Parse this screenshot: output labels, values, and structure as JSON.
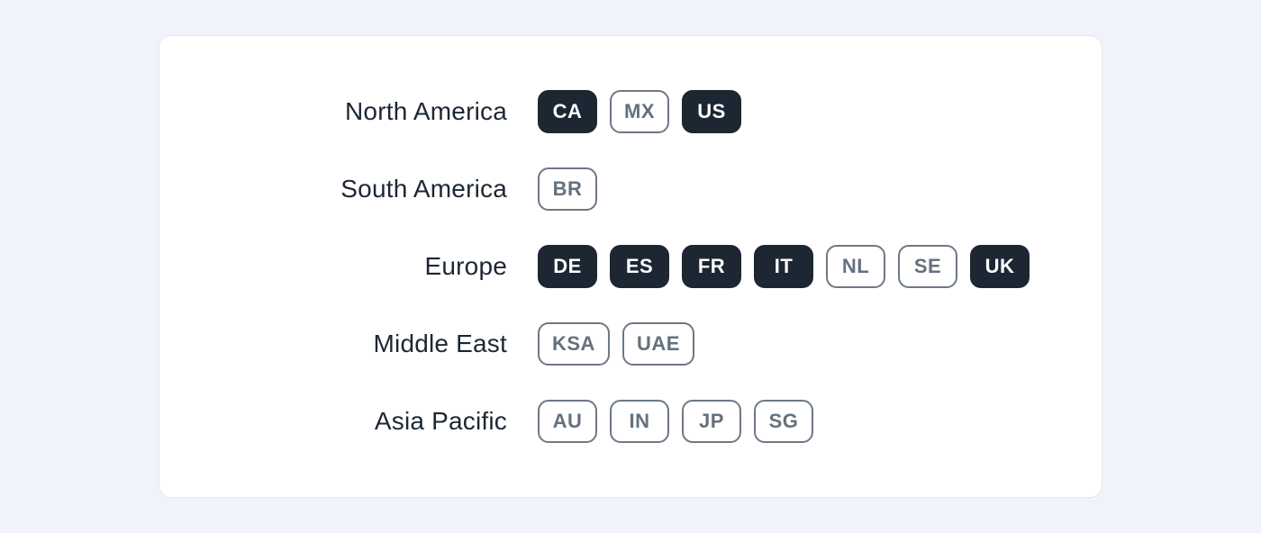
{
  "regions": [
    {
      "label": "North America",
      "chips": [
        {
          "code": "CA",
          "selected": true
        },
        {
          "code": "MX",
          "selected": false
        },
        {
          "code": "US",
          "selected": true
        }
      ]
    },
    {
      "label": "South America",
      "chips": [
        {
          "code": "BR",
          "selected": false
        }
      ]
    },
    {
      "label": "Europe",
      "chips": [
        {
          "code": "DE",
          "selected": true
        },
        {
          "code": "ES",
          "selected": true
        },
        {
          "code": "FR",
          "selected": true
        },
        {
          "code": "IT",
          "selected": true
        },
        {
          "code": "NL",
          "selected": false
        },
        {
          "code": "SE",
          "selected": false
        },
        {
          "code": "UK",
          "selected": true
        }
      ]
    },
    {
      "label": "Middle East",
      "chips": [
        {
          "code": "KSA",
          "selected": false
        },
        {
          "code": "UAE",
          "selected": false
        }
      ]
    },
    {
      "label": "Asia Pacific",
      "chips": [
        {
          "code": "AU",
          "selected": false
        },
        {
          "code": "IN",
          "selected": false
        },
        {
          "code": "JP",
          "selected": false
        },
        {
          "code": "SG",
          "selected": false
        }
      ]
    }
  ]
}
